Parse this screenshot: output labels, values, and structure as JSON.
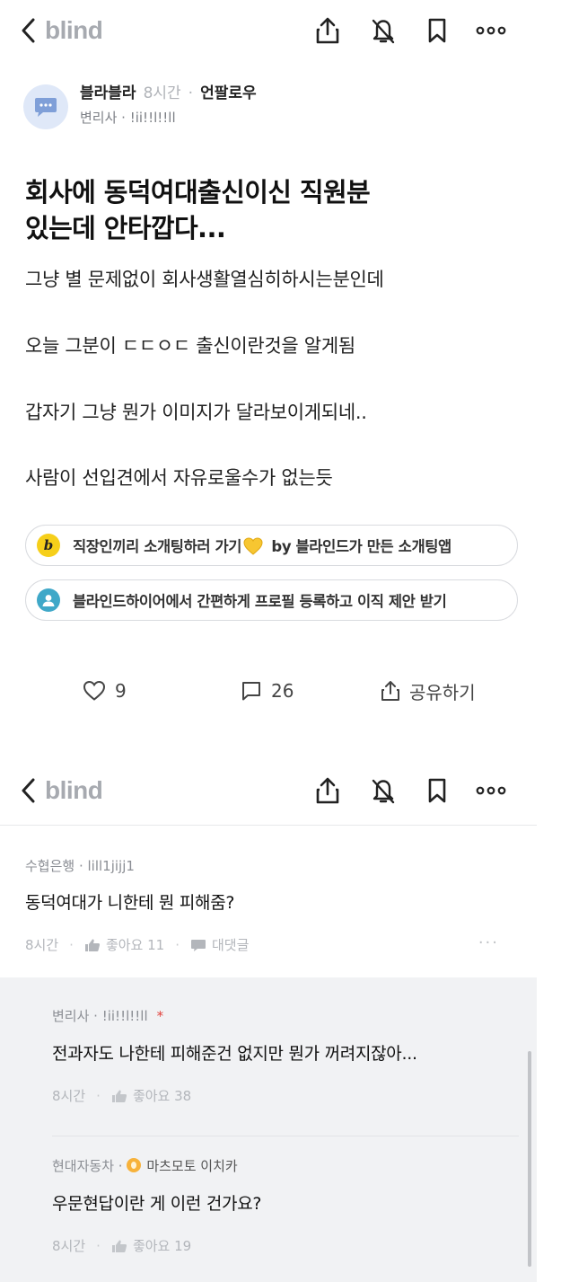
{
  "app": {
    "brand": "blind"
  },
  "post": {
    "author_name": "블라블라",
    "time": "8시간",
    "separator": "·",
    "unfollow": "언팔로우",
    "company": "변리사 · !ii!!l!!ll",
    "title_line1": "회사에 동덕여대출신이신 직원분",
    "title_line2": "있는데 안타깝다...",
    "body": [
      "그냥 별 문제없이 회사생활열심히하시는분인데",
      "오늘 그분이 ㄷㄷㅇㄷ 출신이란것을 알게됨",
      "갑자기 그냥 뭔가 이미지가 달라보이게되네..",
      "사람이 선입견에서 자유로울수가 없는듯"
    ]
  },
  "promos": [
    {
      "icon": "b",
      "text_before": "직장인끼리 소개팅하러 가기",
      "text_after": " by 블라인드가 만든 소개팅앱"
    },
    {
      "icon": "person",
      "text": "블라인드하이어에서 간편하게 프로필 등록하고 이직 제안 받기"
    }
  ],
  "actions": {
    "likes": "9",
    "comments": "26",
    "share": "공유하기"
  },
  "comments": [
    {
      "author": "수협은행 · lill1jijj1",
      "text": "동덕여대가 니한테 뭔 피해줌?",
      "time": "8시간",
      "likes": "좋아요 11",
      "reply": "대댓글",
      "more": "···"
    }
  ],
  "replies": [
    {
      "author": "변리사 · !ii!!l!!ll",
      "op_mark": "*",
      "text": "전과자도 나한테 피해준건 없지만 뭔가 꺼려지잖아...",
      "time": "8시간",
      "likes": "좋아요 38"
    },
    {
      "author": "현대자동차 ·",
      "nickname": "마츠모토 이치카",
      "text": "우문현답이란 게 이런 건가요?",
      "time": "8시간",
      "likes": "좋아요 19"
    }
  ],
  "colors": {
    "brand_gray": "#a7aab0",
    "promo_yellow": "#f6cf1a",
    "promo_teal": "#3fa8c8",
    "reply_bg": "#f1f2f4",
    "op_red": "#e2403a"
  }
}
